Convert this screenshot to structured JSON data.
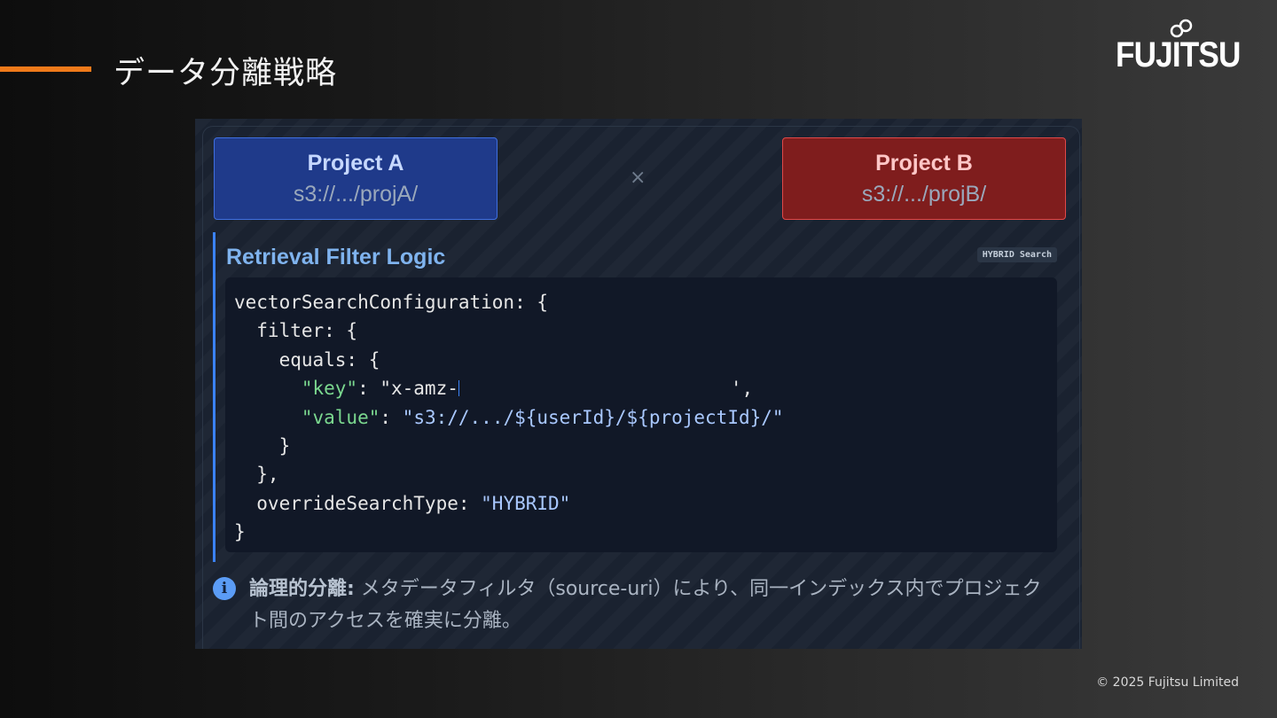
{
  "slide": {
    "title": "データ分離戦略",
    "logo_text": "FUJITSU",
    "copyright": "© 2025 Fujitsu Limited",
    "accent_color": "#ef7a1a"
  },
  "projects": [
    {
      "name": "Project A",
      "path": "s3://.../projA/",
      "color": "#1f3a8a"
    },
    {
      "name": "Project B",
      "path": "s3://.../projB/",
      "color": "#7f1d1d"
    }
  ],
  "separator_icon": "times-icon",
  "separator_symbol": "×",
  "filter": {
    "title": "Retrieval Filter Logic",
    "badge": "HYBRID Search",
    "code": {
      "line1": "vectorSearchConfiguration: {",
      "line2": "  filter: {",
      "line3": "    equals: {",
      "line4_indent": "      ",
      "line4_key": "\"key\"",
      "line4_rest": ": \"x-amz-",
      "line4_tail": "',",
      "line5_indent": "      ",
      "line5_key": "\"value\"",
      "line5_sep": ": ",
      "line5_val": "\"s3://.../${userId}/${projectId}/\"",
      "line6": "    }",
      "line7": "  },",
      "line8_pre": "  overrideSearchType: ",
      "line8_val": "\"HYBRID\"",
      "line9": "}"
    }
  },
  "info": {
    "icon": "info-icon",
    "strong": "論理的分離:",
    "text": " メタデータフィルタ（source-uri）により、同一インデックス内でプロジェクト間のアクセスを確実に分離。"
  }
}
